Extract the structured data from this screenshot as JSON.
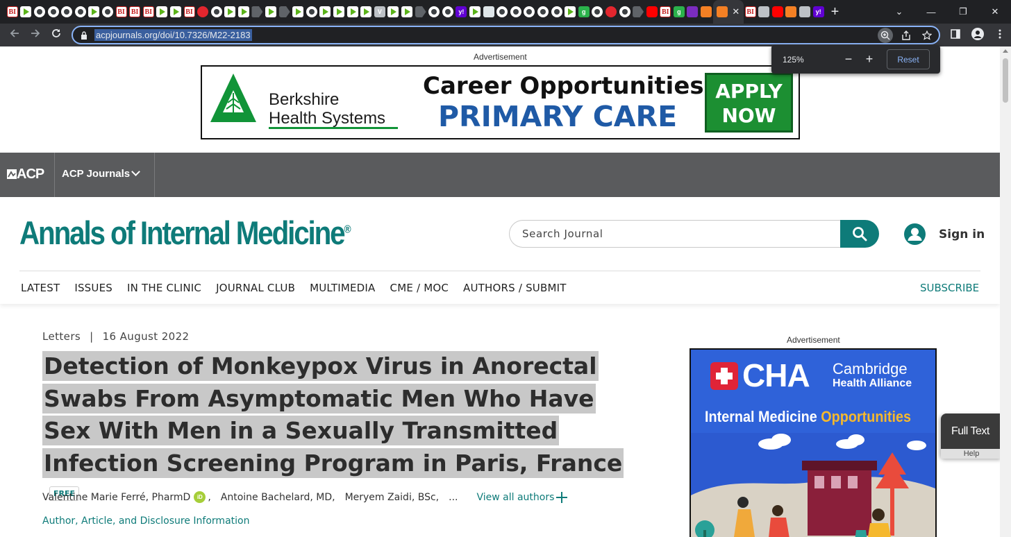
{
  "browser": {
    "tab_favicons": [
      "bi",
      "play",
      "circle",
      "circle",
      "circle",
      "circle",
      "play",
      "circle",
      "bi",
      "bi",
      "bi",
      "play",
      "play",
      "bi",
      "red",
      "circle",
      "play",
      "play",
      "doc",
      "play",
      "doc",
      "play",
      "circle",
      "play",
      "play",
      "play",
      "play",
      "v",
      "play",
      "play",
      "doc",
      "circle",
      "circle",
      "yahoo",
      "play",
      "grid",
      "circle",
      "circle",
      "circle",
      "circle",
      "circle",
      "play",
      "green",
      "circle",
      "red",
      "circle",
      "doc",
      "yt",
      "bi",
      "green",
      "purple",
      "orange"
    ],
    "active_tab_icon": "orange",
    "tabs_after": [
      "bi",
      "gray",
      "yt",
      "orange",
      "gray",
      "yahoo"
    ],
    "tab_close_glyph": "✕",
    "new_tab_glyph": "+",
    "window_controls": [
      "⌄",
      "—",
      "❐",
      "✕"
    ],
    "url": "acpjournals.org/doi/10.7326/M22-2183",
    "zoom_popup": {
      "level": "125%",
      "minus": "−",
      "plus": "+",
      "reset": "Reset"
    }
  },
  "ads": {
    "top_label": "Advertisement",
    "berkshire_line1": "Berkshire",
    "berkshire_line2": "Health Systems",
    "career_line": "Career Opportunities:",
    "primary_line": "PRIMARY CARE",
    "apply_line1": "APPLY",
    "apply_line2": "NOW",
    "side_label": "Advertisement",
    "cha_big": "CHA",
    "cha_line1": "Cambridge",
    "cha_line2": "Health Alliance",
    "im_line": "Internal Medicine ",
    "im_gold": "Opportunities"
  },
  "acp_bar": {
    "logo": "ACP",
    "journals_label": "ACP Journals"
  },
  "masthead": {
    "title": "Annals of Internal Medicine",
    "registered": "®",
    "search_placeholder": "Search Journal",
    "signin": "Sign in",
    "nav": [
      "LATEST",
      "ISSUES",
      "IN THE CLINIC",
      "JOURNAL CLUB",
      "MULTIMEDIA",
      "CME / MOC",
      "AUTHORS / SUBMIT"
    ],
    "subscribe": "SUBSCRIBE"
  },
  "article": {
    "type": "Letters",
    "separator": "|",
    "date": "16 August 2022",
    "title": "Detection of Monkeypox Virus in Anorectal Swabs From Asymptomatic Men Who Have Sex With Men in a Sexually Transmitted Infection Screening Program in Paris, France",
    "badge": "FREE",
    "authors": [
      "Valentine Marie Ferré, PharmD",
      "Antoine Bachelard, MD,",
      "Meryem Zaidi, BSc,"
    ],
    "orcid_label": "iD",
    "author_sep": ",",
    "ellipsis": "...",
    "view_all": "View all authors",
    "info_link": "Author, Article, and Disclosure Information"
  },
  "widget": {
    "label": "Full Text",
    "help": "Help"
  },
  "colors": {
    "teal": "#0e7b79",
    "chrome_dark": "#202124",
    "acp_gray": "#5a5b5d"
  }
}
